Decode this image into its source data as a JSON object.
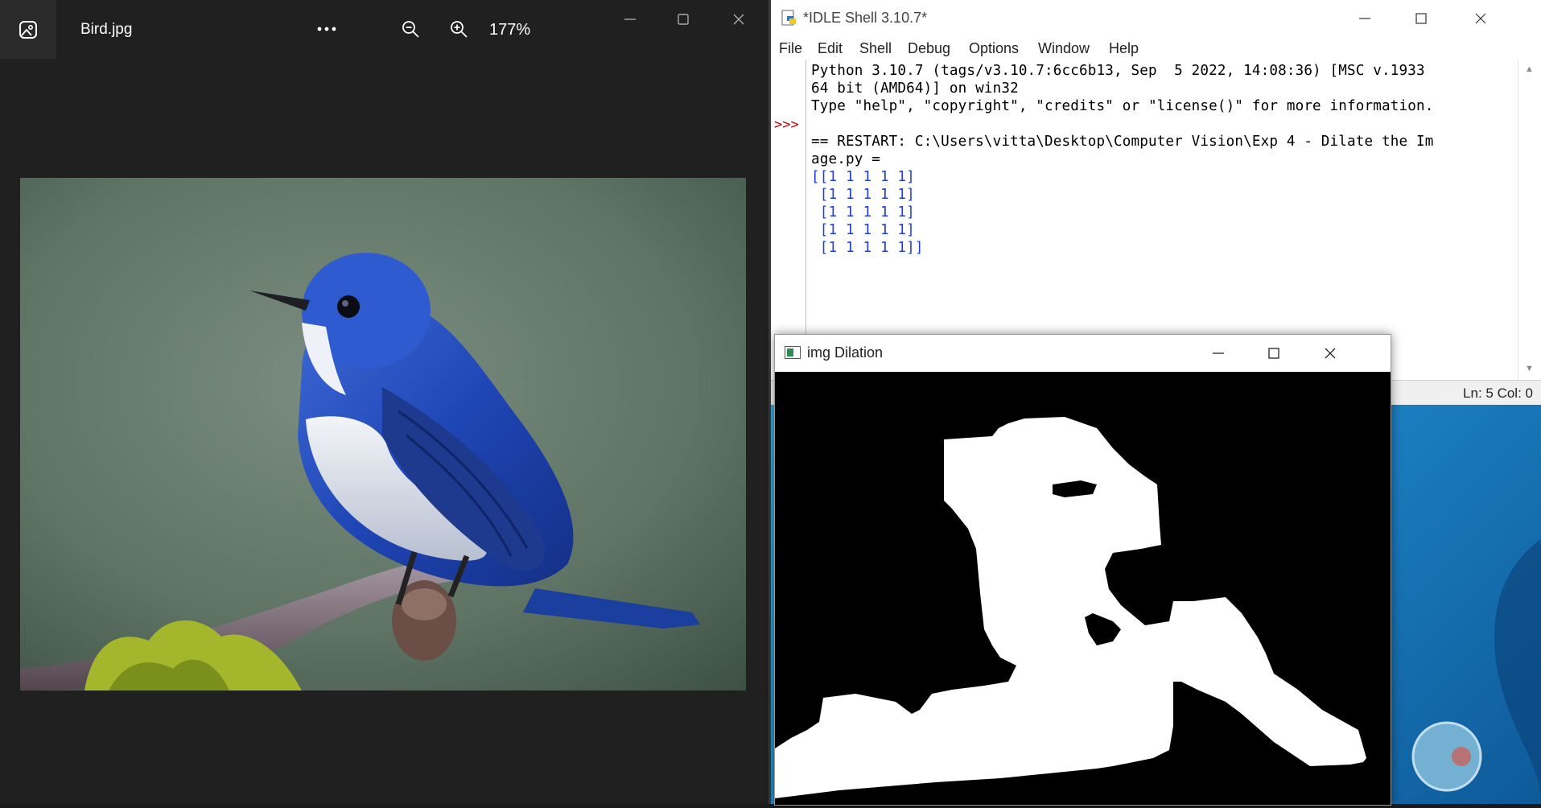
{
  "photos": {
    "file_name": "Bird.jpg",
    "zoom": "177%",
    "icons": {
      "app": "photo-icon",
      "more": "more-icon",
      "zoom_out": "zoom-out-icon",
      "zoom_in": "zoom-in-icon"
    }
  },
  "idle": {
    "title": "*IDLE Shell 3.10.7*",
    "menu": [
      "File",
      "Edit",
      "Shell",
      "Debug",
      "Options",
      "Window",
      "Help"
    ],
    "prompt": ">>>",
    "lines": [
      "Python 3.10.7 (tags/v3.10.7:6cc6b13, Sep  5 2022, 14:08:36) [MSC v.1933",
      "64 bit (AMD64)] on win32",
      "Type \"help\", \"copyright\", \"credits\" or \"license()\" for more information.",
      "",
      "== RESTART: C:\\Users\\vitta\\Desktop\\Computer Vision\\Exp 4 - Dilate the Im",
      "age.py ="
    ],
    "output_lines": [
      "[[1 1 1 1 1]",
      " [1 1 1 1 1]",
      " [1 1 1 1 1]",
      " [1 1 1 1 1]",
      " [1 1 1 1 1]]"
    ],
    "status": "Ln: 5   Col: 0"
  },
  "dilation": {
    "title": "img Dilation"
  }
}
